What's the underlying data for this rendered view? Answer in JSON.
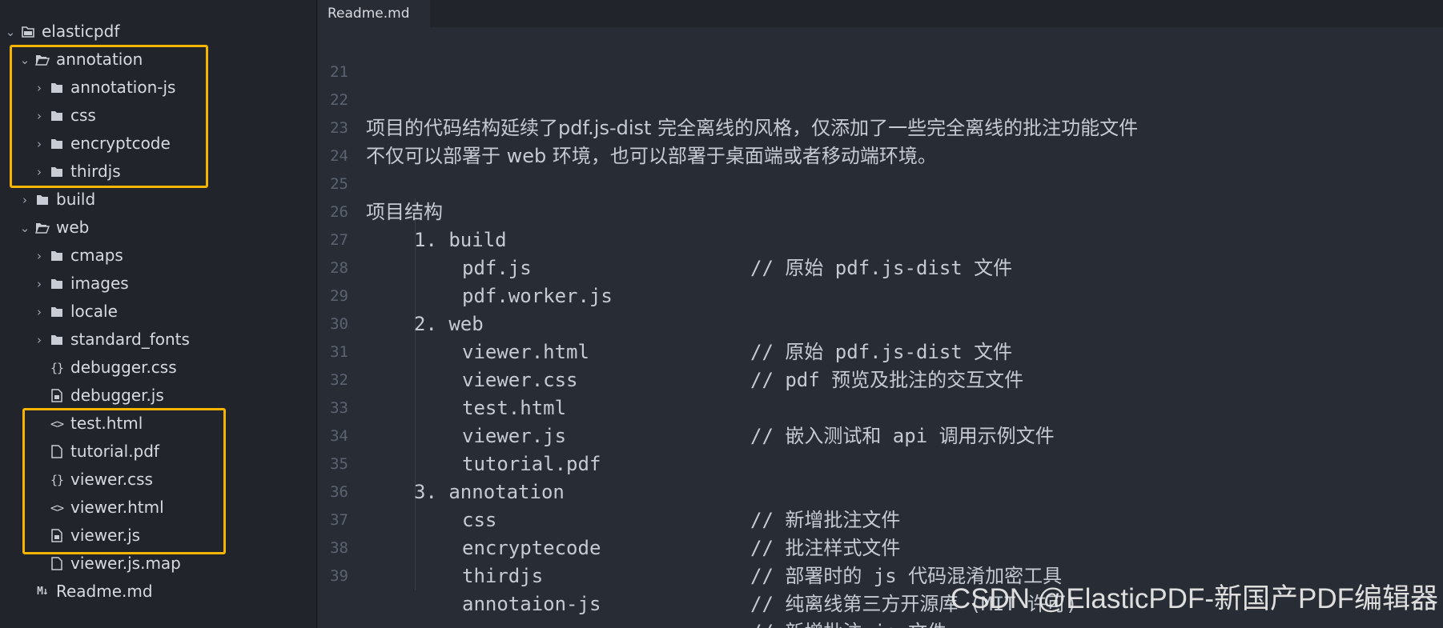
{
  "sidebar": {
    "items": [
      {
        "label": "elasticpdf",
        "chevron": "⌄",
        "icon": "folder-closed-icon"
      },
      {
        "label": "annotation",
        "chevron": "⌄",
        "icon": "folder-open-icon"
      },
      {
        "label": "annotation-js",
        "chevron": "›",
        "icon": "folder-icon"
      },
      {
        "label": "css",
        "chevron": "›",
        "icon": "folder-icon"
      },
      {
        "label": "encryptcode",
        "chevron": "›",
        "icon": "folder-icon"
      },
      {
        "label": "thirdjs",
        "chevron": "›",
        "icon": "folder-icon"
      },
      {
        "label": "build",
        "chevron": "›",
        "icon": "folder-icon"
      },
      {
        "label": "web",
        "chevron": "⌄",
        "icon": "folder-open-icon"
      },
      {
        "label": "cmaps",
        "chevron": "›",
        "icon": "folder-icon"
      },
      {
        "label": "images",
        "chevron": "›",
        "icon": "folder-icon"
      },
      {
        "label": "locale",
        "chevron": "›",
        "icon": "folder-icon"
      },
      {
        "label": "standard_fonts",
        "chevron": "›",
        "icon": "folder-icon"
      },
      {
        "label": "debugger.css",
        "chevron": "",
        "icon": "braces-icon",
        "glyph": "{}"
      },
      {
        "label": "debugger.js",
        "chevron": "",
        "icon": "js-file-icon"
      },
      {
        "label": "test.html",
        "chevron": "",
        "icon": "code-icon",
        "glyph": "<>"
      },
      {
        "label": "tutorial.pdf",
        "chevron": "",
        "icon": "file-icon"
      },
      {
        "label": "viewer.css",
        "chevron": "",
        "icon": "braces-icon",
        "glyph": "{}"
      },
      {
        "label": "viewer.html",
        "chevron": "",
        "icon": "code-icon",
        "glyph": "<>"
      },
      {
        "label": "viewer.js",
        "chevron": "",
        "icon": "js-file-icon"
      },
      {
        "label": "viewer.js.map",
        "chevron": "",
        "icon": "file-icon"
      },
      {
        "label": "Readme.md",
        "chevron": "",
        "icon": "markdown-icon",
        "glyph": "M↓"
      }
    ]
  },
  "editor": {
    "tab": "Readme.md",
    "lines": [
      {
        "num": "21",
        "text": "",
        "comment": ""
      },
      {
        "num": "22",
        "text": "项目的代码结构延续了pdf.js-dist 完全离线的风格，仅添加了一些完全离线的批注功能文件",
        "comment": ""
      },
      {
        "num": "23",
        "text": "不仅可以部署于 web 环境，也可以部署于桌面端或者移动端环境。",
        "comment": ""
      },
      {
        "num": "24",
        "text": "",
        "comment": ""
      },
      {
        "num": "25",
        "text": "项目结构",
        "comment": ""
      },
      {
        "num": "26",
        "text": "1. build",
        "comment": "// 原始 pdf.js-dist 文件"
      },
      {
        "num": "27",
        "text": "pdf.js",
        "comment": ""
      },
      {
        "num": "28",
        "text": "pdf.worker.js",
        "comment": ""
      },
      {
        "num": "29",
        "text": "2. web",
        "comment": "// 原始 pdf.js-dist 文件"
      },
      {
        "num": "30",
        "text": "viewer.html",
        "comment": "// pdf 预览及批注的交互文件"
      },
      {
        "num": "31",
        "text": "viewer.css",
        "comment": ""
      },
      {
        "num": "32",
        "text": "test.html",
        "comment": "// 嵌入测试和 api 调用示例文件"
      },
      {
        "num": "33",
        "text": "viewer.js",
        "comment": ""
      },
      {
        "num": "34",
        "text": "tutorial.pdf",
        "comment": ""
      },
      {
        "num": "35",
        "text": "3. annotation",
        "comment": "// 新增批注文件"
      },
      {
        "num": "36",
        "text": "css",
        "comment": "// 批注样式文件"
      },
      {
        "num": "37",
        "text": "encryptecode",
        "comment": "// 部署时的 js 代码混淆加密工具"
      },
      {
        "num": "38",
        "text": "thirdjs",
        "comment": "// 纯离线第三方开源库 (MIT 许可)"
      },
      {
        "num": "39",
        "text": "annotaion-js",
        "comment": "// 新增批注 js 文件"
      }
    ]
  },
  "watermark": "CSDN @ElasticPDF-新国产PDF编辑器",
  "colors": {
    "sidebar_bg": "#21252b",
    "editor_bg": "#282c34",
    "text": "#d7dae0",
    "line_number": "#5c6370",
    "highlight_box": "#f4b400"
  }
}
